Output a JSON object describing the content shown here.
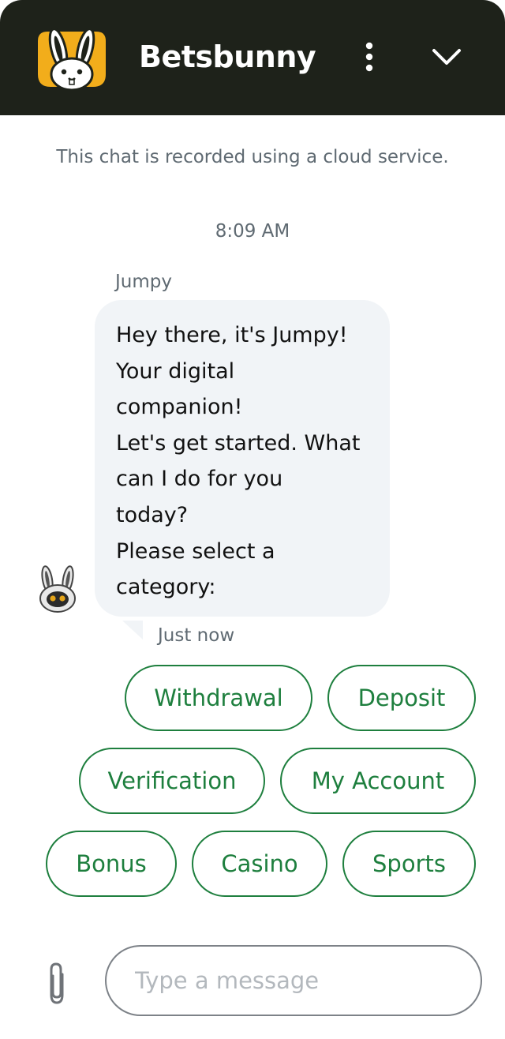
{
  "header": {
    "brand": "Betsbunny",
    "menu_icon": "more-vertical-icon",
    "collapse_icon": "chevron-down-icon",
    "background": "#1e221a",
    "logo_color": "#f2ad1b"
  },
  "chat": {
    "notice": "This chat is recorded using a cloud service.",
    "timestamp": "8:09 AM",
    "message": {
      "sender": "Jumpy",
      "lines": [
        "Hey there, it's Jumpy!",
        "Your digital",
        "companion!",
        "Let's get started. What",
        "can I do for you",
        "today?",
        "Please select a",
        "category:"
      ],
      "time": "Just now"
    },
    "quick_replies": [
      "Withdrawal",
      "Deposit",
      "Verification",
      "My Account",
      "Bonus",
      "Casino",
      "Sports"
    ],
    "accent_color": "#1e7f3e"
  },
  "composer": {
    "placeholder": "Type a message",
    "value": "",
    "attach_icon": "paperclip-icon"
  }
}
